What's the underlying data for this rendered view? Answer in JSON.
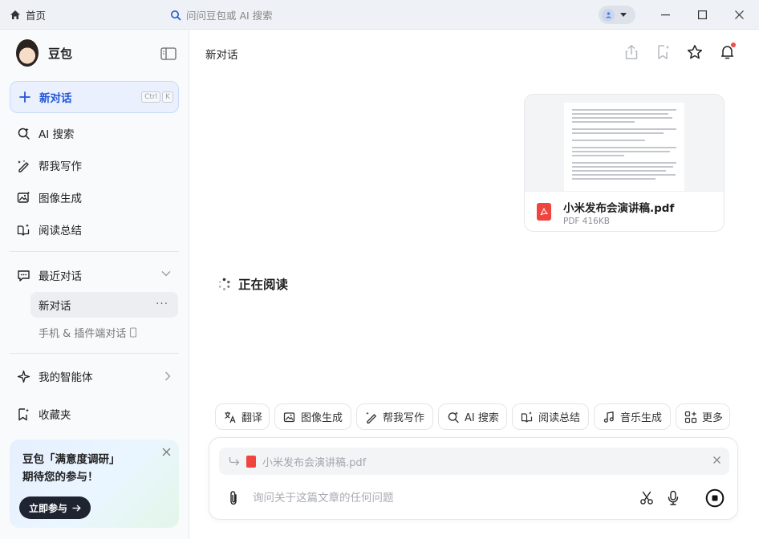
{
  "titlebar": {
    "home_tab": "首页",
    "search_tab": "问问豆包或 AI 搜索"
  },
  "sidebar": {
    "app_name": "豆包",
    "new_chat": "新对话",
    "shortcut_keys": [
      "Ctrl",
      "K"
    ],
    "nav": [
      {
        "label": "AI 搜索",
        "icon": "ai-search-icon"
      },
      {
        "label": "帮我写作",
        "icon": "writing-icon"
      },
      {
        "label": "图像生成",
        "icon": "image-icon"
      },
      {
        "label": "阅读总结",
        "icon": "reading-icon"
      }
    ],
    "recent_label": "最近对话",
    "recent_current": "新对话",
    "recent_mobile": "手机 & 插件端对话",
    "agents": "我的智能体",
    "favorites": "收藏夹",
    "promo": {
      "line1": "豆包「满意度调研」",
      "line2": "期待您的参与！",
      "cta": "立即参与"
    }
  },
  "main": {
    "conversation_title": "新对话",
    "file": {
      "name": "小米发布会演讲稿.pdf",
      "meta": "PDF 416KB"
    },
    "status": "正在阅读",
    "chips": [
      "翻译",
      "图像生成",
      "帮我写作",
      "AI 搜索",
      "阅读总结",
      "音乐生成",
      "更多"
    ],
    "composer": {
      "attached_file": "小米发布会演讲稿.pdf",
      "placeholder": "询问关于这篇文章的任何问题"
    }
  },
  "colors": {
    "accent": "#2156d6",
    "new_chat_bg": "#eaf0fd",
    "pdf_red": "#f0443e",
    "notify_red": "#f24b4b"
  }
}
